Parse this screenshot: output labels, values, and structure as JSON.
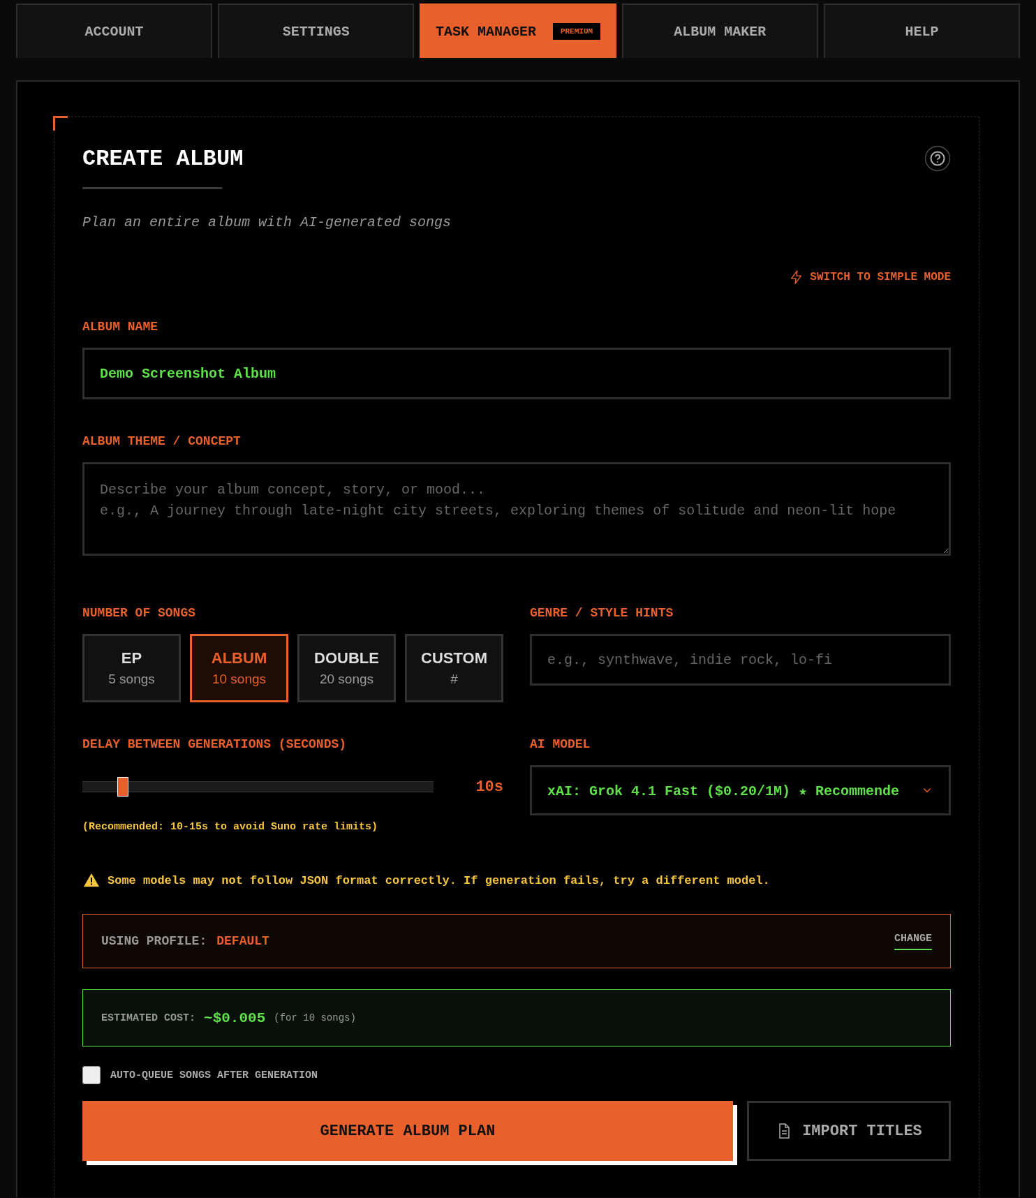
{
  "tabs": [
    {
      "label": "ACCOUNT",
      "selected": false
    },
    {
      "label": "SETTINGS",
      "selected": false
    },
    {
      "label": "TASK MANAGER",
      "selected": true,
      "badge": "PREMIUM"
    },
    {
      "label": "ALBUM MAKER",
      "selected": false
    },
    {
      "label": "HELP",
      "selected": false
    }
  ],
  "card": {
    "title": "CREATE ALBUM",
    "subtitle": "Plan an entire album with AI-generated songs",
    "mode_link": "SWITCH TO SIMPLE MODE",
    "album_name": {
      "label": "ALBUM NAME",
      "value": "Demo Screenshot Album"
    },
    "theme": {
      "label": "ALBUM THEME / CONCEPT",
      "placeholder": "Describe your album concept, story, or mood...\ne.g., A journey through late-night city streets, exploring themes of solitude and neon-lit hope"
    },
    "songs": {
      "label": "NUMBER OF SONGS",
      "options": [
        {
          "title": "EP",
          "detail": "5 songs",
          "selected": false
        },
        {
          "title": "ALBUM",
          "detail": "10 songs",
          "selected": true
        },
        {
          "title": "DOUBLE",
          "detail": "20 songs",
          "selected": false
        },
        {
          "title": "CUSTOM",
          "detail": "#",
          "selected": false
        }
      ]
    },
    "genre": {
      "label": "GENRE / STYLE HINTS",
      "placeholder": "e.g., synthwave, indie rock, lo-fi"
    },
    "delay": {
      "label": "DELAY BETWEEN GENERATIONS (SECONDS)",
      "level": 0.1,
      "reading": "10s",
      "note": "(Recommended: 10-15s to avoid Suno rate limits)"
    },
    "model": {
      "label": "AI MODEL",
      "value": "xAI: Grok 4.1 Fast ($0.20/1M) ★ Recommende"
    },
    "warning": "Some models may not follow JSON format correctly. If generation fails, try a different model.",
    "profile": {
      "label": "USING PROFILE:",
      "value": "DEFAULT",
      "action": "CHANGE"
    },
    "cost": {
      "label": "ESTIMATED COST:",
      "value": "~$0.005",
      "note": "(for 10 songs)"
    },
    "auto_queue": {
      "label": "AUTO-QUEUE SONGS AFTER GENERATION",
      "checked": false
    },
    "buttons": [
      {
        "kind": "primary",
        "label": "GENERATE ALBUM PLAN"
      },
      {
        "kind": "secondary",
        "label": "IMPORT TITLES"
      }
    ]
  }
}
